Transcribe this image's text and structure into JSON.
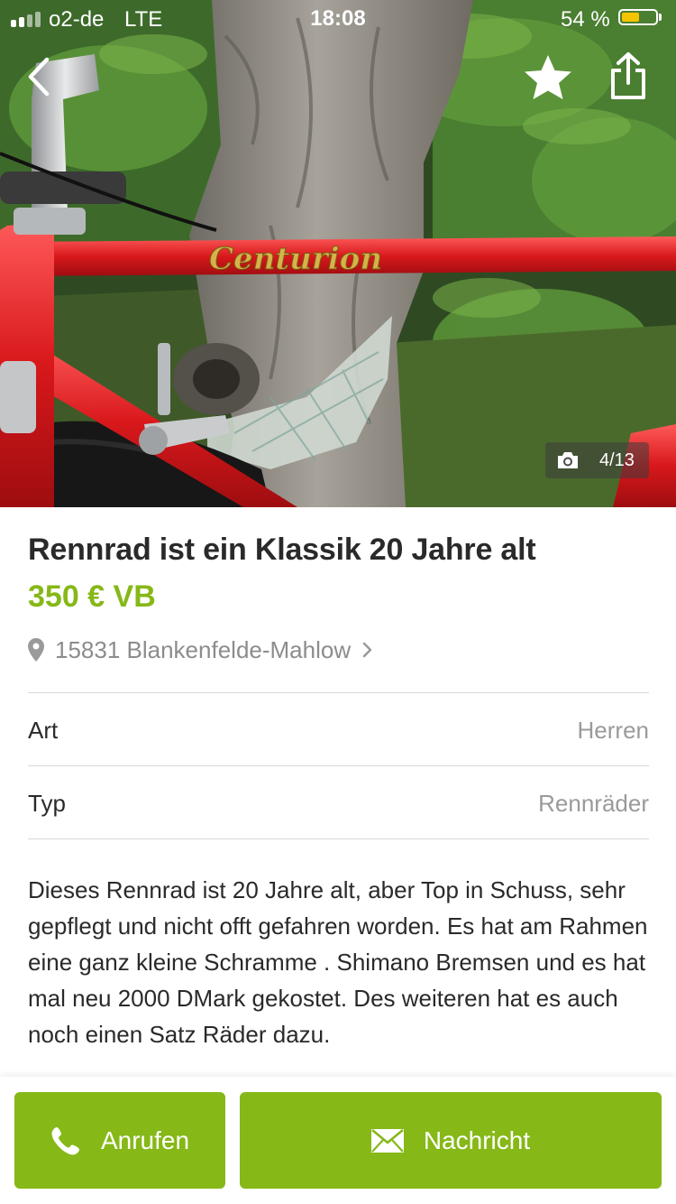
{
  "status_bar": {
    "carrier": "o2-de",
    "network": "LTE",
    "time": "18:08",
    "battery_percent": "54 %",
    "battery_level": 0.54,
    "battery_color": "#f5c400"
  },
  "toolbar": {
    "back_icon": "chevron-left-icon",
    "favorite_icon": "star-icon",
    "share_icon": "share-icon"
  },
  "gallery": {
    "counter": "4/13",
    "counter_icon": "camera-icon",
    "photo_brand_lettering": "Centurion"
  },
  "listing": {
    "title": "Rennrad ist ein Klassik 20 Jahre alt",
    "price": "350 € VB",
    "location": "15831 Blankenfelde-Mahlow",
    "attributes": [
      {
        "label": "Art",
        "value": "Herren"
      },
      {
        "label": "Typ",
        "value": "Rennräder"
      }
    ],
    "description": "Dieses Rennrad ist 20 Jahre alt, aber Top in Schuss, sehr gepflegt und nicht offt gefahren worden. Es hat am Rahmen eine ganz kleine Schramme . Shimano Bremsen und es hat mal neu 2000 DMark gekostet. Des weiteren hat es auch noch einen Satz Räder dazu."
  },
  "actions": {
    "call_label": "Anrufen",
    "message_label": "Nachricht"
  },
  "colors": {
    "accent": "#86b817",
    "text": "#2a2a2a",
    "muted": "#8c8c8c"
  }
}
